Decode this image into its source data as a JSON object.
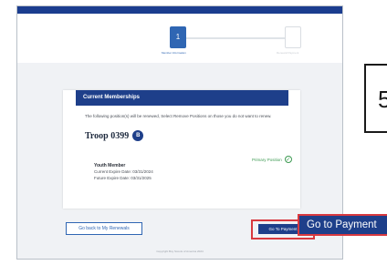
{
  "stepper": {
    "steps": [
      {
        "number": "1",
        "label": "Member Information"
      },
      {
        "number": "",
        "label": "Renewal Payment"
      }
    ]
  },
  "card": {
    "title": "Current Memberships",
    "description": "The following position(s) will be renewed, Select Remove Positions on those you do not want to renew.",
    "unit": {
      "name": "Troop 0399",
      "badge": "B"
    },
    "member": {
      "type": "Youth Member",
      "current_expire": "Current Expire Date: 03/31/2024",
      "future_expire": "Future Expire Date: 03/31/2025",
      "primary_position": "Primary Position"
    }
  },
  "buttons": {
    "back": "Go back to My Renewals",
    "pay": "Go To Payment"
  },
  "footer": {
    "copyright": "Copyright Boy Scouts of America 2024"
  },
  "annotations": {
    "step_number": "5",
    "callout": "Go to Payment"
  },
  "colors": {
    "brand": "#1e3f8a",
    "highlight": "#d8393f",
    "success": "#3e9b53"
  }
}
